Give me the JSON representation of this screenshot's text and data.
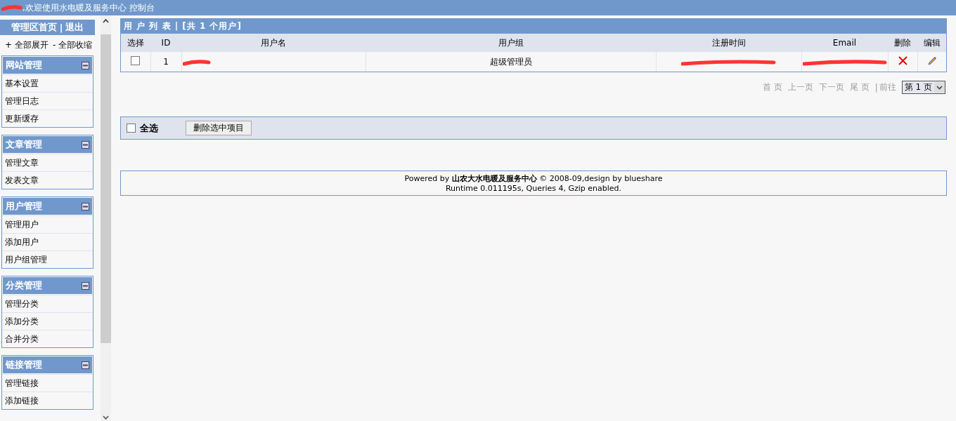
{
  "header": {
    "title": ",欢迎使用水电暖及服务中心 控制台"
  },
  "sidebar": {
    "top_links": [
      "管理区首页",
      "退出"
    ],
    "top_separator": "|",
    "expand_all": "+ 全部展开",
    "collapse_all": "- 全部收缩",
    "groups": [
      {
        "title": "网站管理",
        "expanded": true,
        "items": [
          "基本设置",
          "管理日志",
          "更新缓存"
        ]
      },
      {
        "title": "文章管理",
        "expanded": true,
        "items": [
          "管理文章",
          "发表文章"
        ]
      },
      {
        "title": "用户管理",
        "expanded": true,
        "items": [
          "管理用户",
          "添加用户",
          "用户组管理"
        ]
      },
      {
        "title": "分类管理",
        "expanded": true,
        "items": [
          "管理分类",
          "添加分类",
          "合并分类"
        ]
      },
      {
        "title": "链接管理",
        "expanded": true,
        "items": [
          "管理链接",
          "添加链接"
        ]
      }
    ]
  },
  "user_list": {
    "title": "用 户 列 表 | [共 1 个用户]",
    "columns": [
      "选择",
      "ID",
      "用户名",
      "用户组",
      "注册时间",
      "Email",
      "删除",
      "编辑"
    ],
    "rows": [
      {
        "checked": false,
        "id": "1",
        "group": "超级管理员"
      }
    ]
  },
  "pagination": {
    "links": [
      "首 页",
      "上一页",
      "下一页",
      "尾 页"
    ],
    "separator": "|",
    "goto": "前往",
    "page_select": "第 1 页"
  },
  "bulk_bar": {
    "select_all": {
      "label": "全选",
      "checked": false
    },
    "delete_button": "删除选中项目"
  },
  "footer": {
    "lines": [
      "Powered by **山农大水电暖及服务中心** © 2008-09,design by blueshare",
      "Runtime 0.011195s, Queries 4, Gzip enabled."
    ]
  }
}
